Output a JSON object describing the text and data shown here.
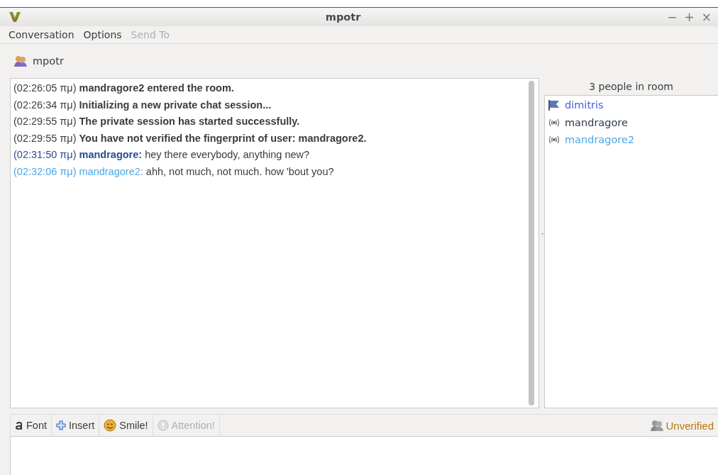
{
  "window": {
    "title": "mpotr",
    "controls": [
      "−",
      "+",
      "×"
    ]
  },
  "menu": [
    {
      "label": "Conversation",
      "disabled": false
    },
    {
      "label": "Options",
      "disabled": false
    },
    {
      "label": "Send To",
      "disabled": true
    }
  ],
  "tab": {
    "label": "mpotr"
  },
  "messages": [
    {
      "kind": "system",
      "time": "(02:26:05 πμ)",
      "text": "mandragore2 entered the room."
    },
    {
      "kind": "system",
      "time": "(02:26:34 πμ)",
      "text": "Initializing a new private chat session..."
    },
    {
      "kind": "system",
      "time": "(02:29:55 πμ)",
      "text": "The private session has started successfully."
    },
    {
      "kind": "system",
      "time": "(02:29:55 πμ)",
      "text": "You have not verified the fingerprint of user: mandragore2."
    },
    {
      "kind": "own",
      "time": "(02:31:50 πμ)",
      "sender": "mandragore:",
      "text": "hey there everybody, anything new?",
      "color": "#2a4f8f"
    },
    {
      "kind": "other",
      "time": "(02:32:06 πμ)",
      "sender": "mandragore2:",
      "text": "ahh, not much, not much. how 'bout you?",
      "color": "#4aa8e8"
    }
  ],
  "people": {
    "heading": "3 people in room",
    "items": [
      {
        "name": "dimitris",
        "kind": "flag",
        "color": "#4a5fe0"
      },
      {
        "name": "mandragore",
        "kind": "signal",
        "color": "#2e3a4a"
      },
      {
        "name": "mandragore2",
        "kind": "signal",
        "color": "#4aa8e8"
      }
    ]
  },
  "toolbar": [
    {
      "label": "Font",
      "kind": "font",
      "disabled": false
    },
    {
      "label": "Insert",
      "kind": "insert",
      "disabled": false
    },
    {
      "label": "Smile!",
      "kind": "smile",
      "disabled": false
    },
    {
      "label": "Attention!",
      "kind": "attention",
      "disabled": true
    }
  ],
  "status": {
    "label": "Unverified"
  }
}
